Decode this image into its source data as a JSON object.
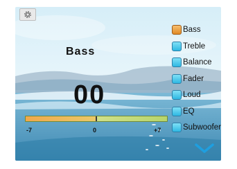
{
  "settings": {
    "icon": "gear-icon"
  },
  "current": {
    "label": "Bass",
    "value": "00"
  },
  "slider": {
    "min_label": "-7",
    "mid_label": "0",
    "max_label": "+7",
    "min": -7,
    "max": 7,
    "value": 0
  },
  "menu": {
    "items": [
      {
        "label": "Bass",
        "active": true
      },
      {
        "label": "Treble",
        "active": false
      },
      {
        "label": "Balance",
        "active": false
      },
      {
        "label": "Fader",
        "active": false
      },
      {
        "label": "Loud",
        "active": false
      },
      {
        "label": "EQ",
        "active": false
      },
      {
        "label": "Subwoofer",
        "active": false
      }
    ]
  },
  "more": {
    "icon": "chevron-down-icon"
  },
  "colors": {
    "active": "#e08a26",
    "inactive": "#2eb8e3",
    "chevron": "#1e9fe0"
  }
}
